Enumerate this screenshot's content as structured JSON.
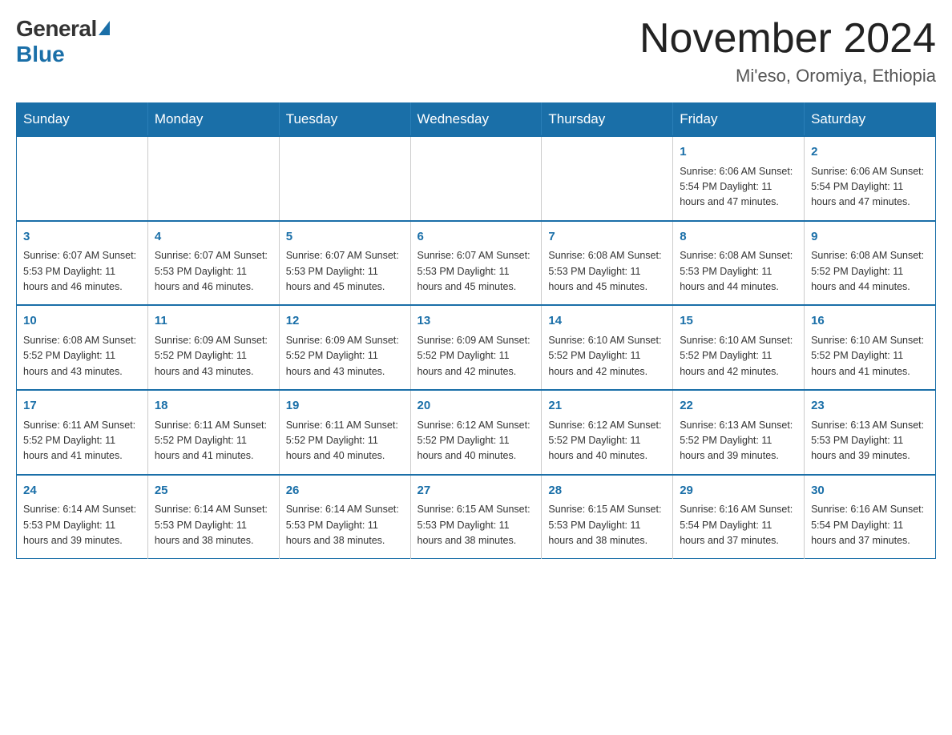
{
  "logo": {
    "general": "General",
    "blue": "Blue"
  },
  "title": "November 2024",
  "subtitle": "Mi'eso, Oromiya, Ethiopia",
  "days_of_week": [
    "Sunday",
    "Monday",
    "Tuesday",
    "Wednesday",
    "Thursday",
    "Friday",
    "Saturday"
  ],
  "weeks": [
    [
      {
        "day": "",
        "info": ""
      },
      {
        "day": "",
        "info": ""
      },
      {
        "day": "",
        "info": ""
      },
      {
        "day": "",
        "info": ""
      },
      {
        "day": "",
        "info": ""
      },
      {
        "day": "1",
        "info": "Sunrise: 6:06 AM\nSunset: 5:54 PM\nDaylight: 11 hours and 47 minutes."
      },
      {
        "day": "2",
        "info": "Sunrise: 6:06 AM\nSunset: 5:54 PM\nDaylight: 11 hours and 47 minutes."
      }
    ],
    [
      {
        "day": "3",
        "info": "Sunrise: 6:07 AM\nSunset: 5:53 PM\nDaylight: 11 hours and 46 minutes."
      },
      {
        "day": "4",
        "info": "Sunrise: 6:07 AM\nSunset: 5:53 PM\nDaylight: 11 hours and 46 minutes."
      },
      {
        "day": "5",
        "info": "Sunrise: 6:07 AM\nSunset: 5:53 PM\nDaylight: 11 hours and 45 minutes."
      },
      {
        "day": "6",
        "info": "Sunrise: 6:07 AM\nSunset: 5:53 PM\nDaylight: 11 hours and 45 minutes."
      },
      {
        "day": "7",
        "info": "Sunrise: 6:08 AM\nSunset: 5:53 PM\nDaylight: 11 hours and 45 minutes."
      },
      {
        "day": "8",
        "info": "Sunrise: 6:08 AM\nSunset: 5:53 PM\nDaylight: 11 hours and 44 minutes."
      },
      {
        "day": "9",
        "info": "Sunrise: 6:08 AM\nSunset: 5:52 PM\nDaylight: 11 hours and 44 minutes."
      }
    ],
    [
      {
        "day": "10",
        "info": "Sunrise: 6:08 AM\nSunset: 5:52 PM\nDaylight: 11 hours and 43 minutes."
      },
      {
        "day": "11",
        "info": "Sunrise: 6:09 AM\nSunset: 5:52 PM\nDaylight: 11 hours and 43 minutes."
      },
      {
        "day": "12",
        "info": "Sunrise: 6:09 AM\nSunset: 5:52 PM\nDaylight: 11 hours and 43 minutes."
      },
      {
        "day": "13",
        "info": "Sunrise: 6:09 AM\nSunset: 5:52 PM\nDaylight: 11 hours and 42 minutes."
      },
      {
        "day": "14",
        "info": "Sunrise: 6:10 AM\nSunset: 5:52 PM\nDaylight: 11 hours and 42 minutes."
      },
      {
        "day": "15",
        "info": "Sunrise: 6:10 AM\nSunset: 5:52 PM\nDaylight: 11 hours and 42 minutes."
      },
      {
        "day": "16",
        "info": "Sunrise: 6:10 AM\nSunset: 5:52 PM\nDaylight: 11 hours and 41 minutes."
      }
    ],
    [
      {
        "day": "17",
        "info": "Sunrise: 6:11 AM\nSunset: 5:52 PM\nDaylight: 11 hours and 41 minutes."
      },
      {
        "day": "18",
        "info": "Sunrise: 6:11 AM\nSunset: 5:52 PM\nDaylight: 11 hours and 41 minutes."
      },
      {
        "day": "19",
        "info": "Sunrise: 6:11 AM\nSunset: 5:52 PM\nDaylight: 11 hours and 40 minutes."
      },
      {
        "day": "20",
        "info": "Sunrise: 6:12 AM\nSunset: 5:52 PM\nDaylight: 11 hours and 40 minutes."
      },
      {
        "day": "21",
        "info": "Sunrise: 6:12 AM\nSunset: 5:52 PM\nDaylight: 11 hours and 40 minutes."
      },
      {
        "day": "22",
        "info": "Sunrise: 6:13 AM\nSunset: 5:52 PM\nDaylight: 11 hours and 39 minutes."
      },
      {
        "day": "23",
        "info": "Sunrise: 6:13 AM\nSunset: 5:53 PM\nDaylight: 11 hours and 39 minutes."
      }
    ],
    [
      {
        "day": "24",
        "info": "Sunrise: 6:14 AM\nSunset: 5:53 PM\nDaylight: 11 hours and 39 minutes."
      },
      {
        "day": "25",
        "info": "Sunrise: 6:14 AM\nSunset: 5:53 PM\nDaylight: 11 hours and 38 minutes."
      },
      {
        "day": "26",
        "info": "Sunrise: 6:14 AM\nSunset: 5:53 PM\nDaylight: 11 hours and 38 minutes."
      },
      {
        "day": "27",
        "info": "Sunrise: 6:15 AM\nSunset: 5:53 PM\nDaylight: 11 hours and 38 minutes."
      },
      {
        "day": "28",
        "info": "Sunrise: 6:15 AM\nSunset: 5:53 PM\nDaylight: 11 hours and 38 minutes."
      },
      {
        "day": "29",
        "info": "Sunrise: 6:16 AM\nSunset: 5:54 PM\nDaylight: 11 hours and 37 minutes."
      },
      {
        "day": "30",
        "info": "Sunrise: 6:16 AM\nSunset: 5:54 PM\nDaylight: 11 hours and 37 minutes."
      }
    ]
  ]
}
